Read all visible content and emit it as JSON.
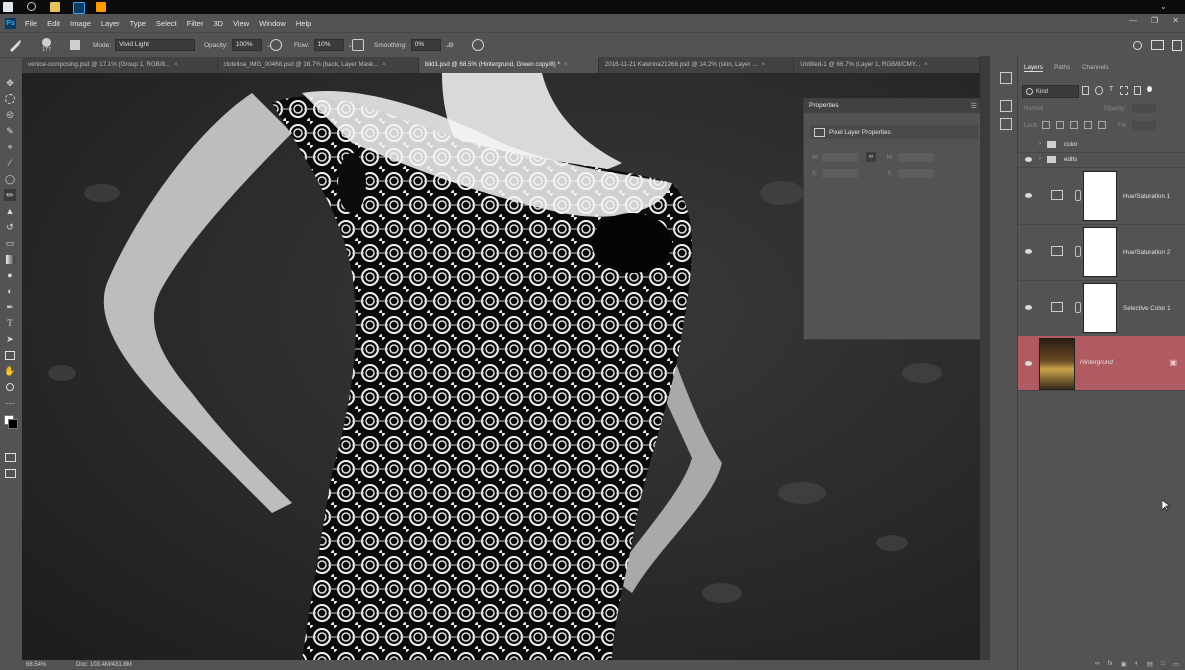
{
  "menubar": {
    "app_icon": "Ps",
    "items": [
      "File",
      "Edit",
      "Image",
      "Layer",
      "Type",
      "Select",
      "Filter",
      "3D",
      "View",
      "Window",
      "Help"
    ]
  },
  "options": {
    "brush_size": "177",
    "mode_label": "Mode:",
    "mode_value": "Vivid Light",
    "opacity_label": "Opacity:",
    "opacity_value": "100%",
    "flow_label": "Flow:",
    "flow_value": "10%",
    "smoothing_label": "Smoothing:",
    "smoothing_value": "0%"
  },
  "tabs": [
    {
      "label": "venice-composing.psd @ 17.1% (Group 1, RGB/8..."
    },
    {
      "label": "clotelina_IMG_00468.psd @ 16.7% (back, Layer Mask..."
    },
    {
      "label": "bild1.psd @ 68.5% (Hintergrund, Green copy/8) *",
      "active": true
    },
    {
      "label": "2016-11-21 Katerina21268.psd @ 14.2% (skin, Layer ..."
    },
    {
      "label": "Untitled-1 @ 66.7% (Layer 1, RGB/8/CMY..."
    }
  ],
  "statusbar": {
    "zoom": "68.54%",
    "doc": "Doc: 103.4M/431.8M"
  },
  "properties": {
    "title": "Properties",
    "subtitle": "Pixel Layer Properties",
    "w_label": "W:",
    "h_label": "H:",
    "x_label": "X:",
    "y_label": "Y:"
  },
  "layers_panel": {
    "tabs": [
      "Layers",
      "Paths",
      "Channels"
    ],
    "kind_label": "Kind",
    "blend": "Normal",
    "opacity_label": "Opacity:",
    "lock_label": "Lock:",
    "fill_label": "Fill:",
    "layers": [
      {
        "name": "color",
        "type": "group"
      },
      {
        "name": "edits",
        "type": "group"
      },
      {
        "name": "Hue/Saturation 1",
        "type": "adjustment"
      },
      {
        "name": "Hue/Saturation 2",
        "type": "adjustment"
      },
      {
        "name": "Selective Color 1",
        "type": "adjustment"
      },
      {
        "name": "Hintergrund",
        "type": "background",
        "selected": true
      }
    ]
  },
  "colors": {
    "panel": "#535353",
    "dark": "#424242",
    "selected_layer": "#b05a62",
    "ps_blue": "#31a8ff"
  }
}
